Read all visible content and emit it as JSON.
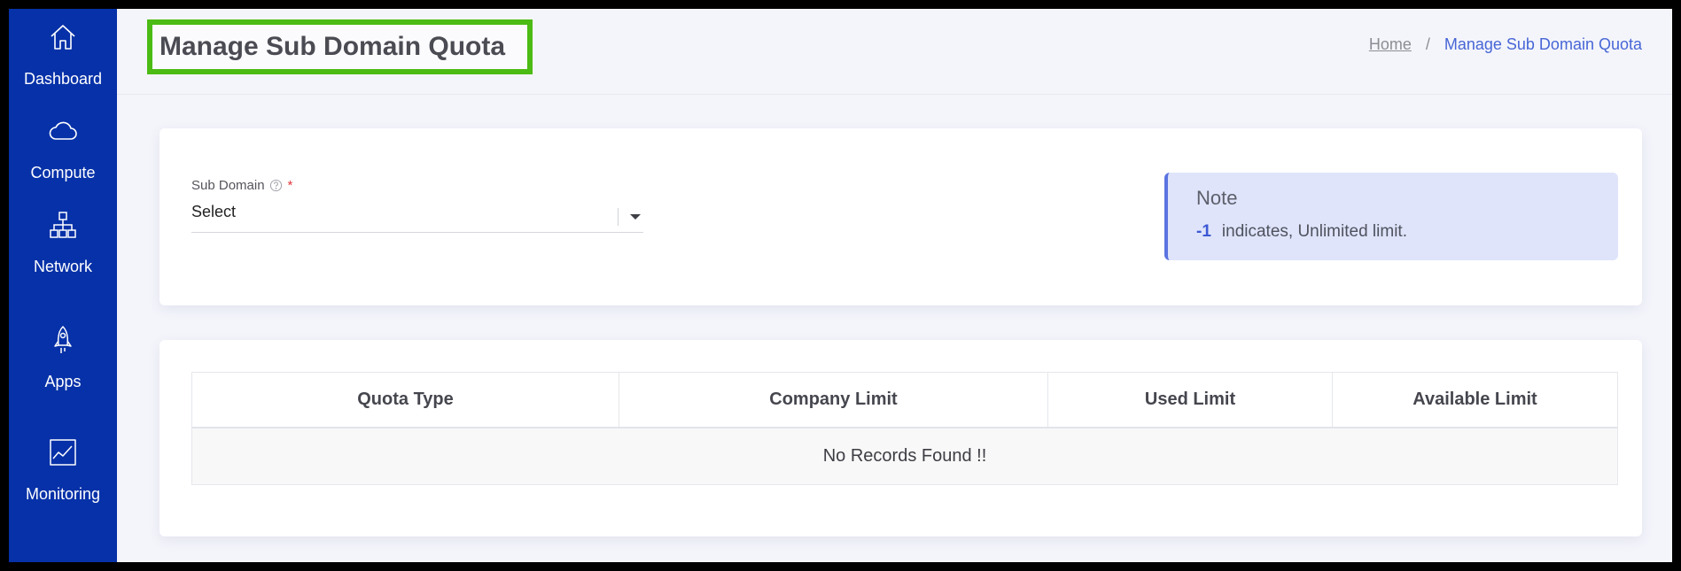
{
  "sidebar": {
    "items": [
      {
        "label": "Dashboard",
        "icon": "home-icon"
      },
      {
        "label": "Compute",
        "icon": "cloud-icon"
      },
      {
        "label": "Network",
        "icon": "network-icon"
      },
      {
        "label": "Apps",
        "icon": "rocket-icon"
      },
      {
        "label": "Monitoring",
        "icon": "chart-icon"
      }
    ]
  },
  "header": {
    "title": "Manage Sub Domain Quota",
    "breadcrumb": {
      "home": "Home",
      "separator": "/",
      "current": "Manage Sub Domain Quota"
    }
  },
  "form": {
    "sub_domain_label": "Sub Domain",
    "required_mark": "*",
    "selected_value": "Select"
  },
  "note": {
    "title": "Note",
    "value": "-1",
    "text": "indicates, Unlimited limit."
  },
  "table": {
    "columns": [
      "Quota Type",
      "Company Limit",
      "Used Limit",
      "Available Limit"
    ],
    "empty_message": "No Records Found !!"
  },
  "colors": {
    "sidebar_bg": "#0631a8",
    "accent": "#4766d6",
    "highlight_border": "#4cbb14",
    "note_bg": "#dfe4fb"
  }
}
